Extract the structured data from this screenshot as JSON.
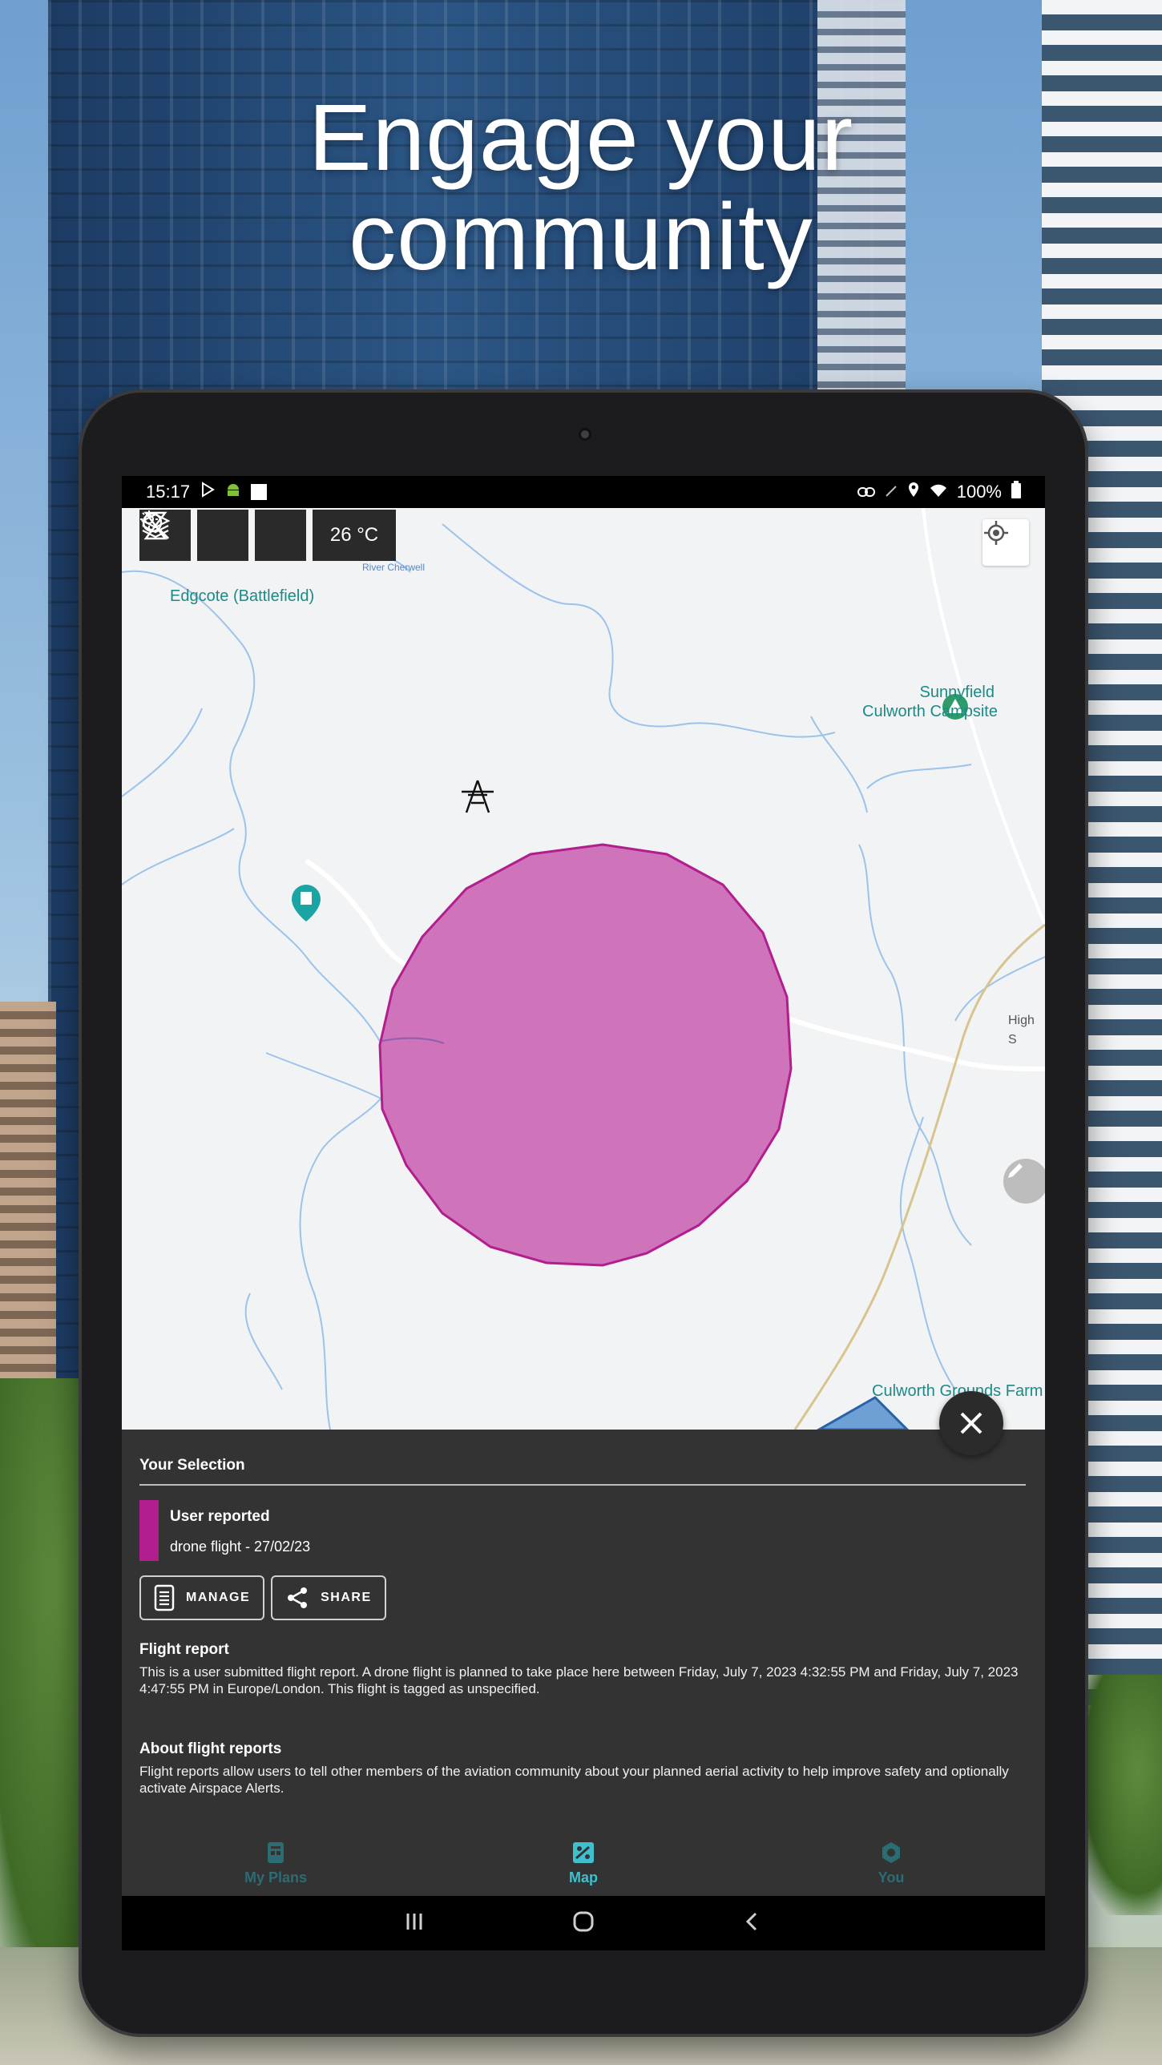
{
  "promo": {
    "headline_line1": "Engage your",
    "headline_line2": "community"
  },
  "status_bar": {
    "time": "15:17",
    "battery": "100%"
  },
  "map": {
    "weather_temp": "26 °C",
    "labels": {
      "edgcote": "Edgcote (Battlefield)",
      "campsite_line1": "Sunnyfield",
      "campsite_line2": "Culworth Campsite",
      "grounds_farm": "Culworth Grounds Farm",
      "high_street": "High S",
      "river": "River Cherwell"
    },
    "zone_color": "#cf73bb",
    "zone_stroke": "#b31e8f"
  },
  "selection": {
    "title": "Your Selection",
    "item_name": "User reported",
    "item_sub": "drone flight - 27/02/23",
    "swatch_color": "#b31e8f",
    "manage_label": "MANAGE",
    "share_label": "SHARE"
  },
  "flight_report": {
    "heading": "Flight report",
    "body": "This is a user submitted flight report. A drone flight is planned to take place here between Friday, July 7, 2023 4:32:55 PM and Friday, July 7, 2023 4:47:55 PM in Europe/London. This flight is tagged as unspecified."
  },
  "about_reports": {
    "heading": "About flight reports",
    "body": "Flight reports allow users to tell other members of the aviation community about your planned aerial activity to help improve safety and optionally activate Airspace Alerts."
  },
  "bottom_nav": {
    "items": [
      {
        "label": "My Plans",
        "icon": "plans-icon",
        "active": false
      },
      {
        "label": "Map",
        "icon": "map-icon",
        "active": true
      },
      {
        "label": "You",
        "icon": "settings-icon",
        "active": false
      }
    ]
  },
  "colors": {
    "accent": "#3fc0cf",
    "sheet_bg": "#333333"
  }
}
